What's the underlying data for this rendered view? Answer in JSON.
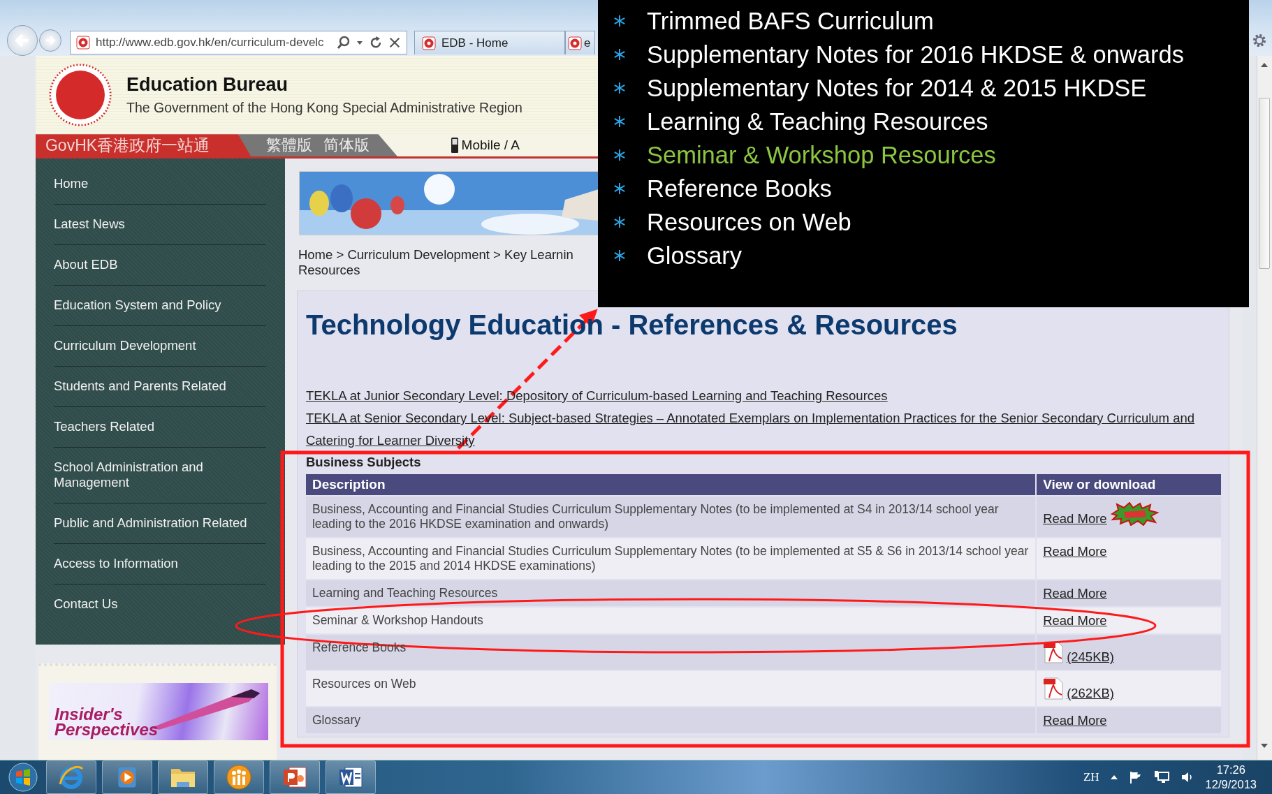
{
  "browser": {
    "address": "http://www.edb.gov.hk/en/curriculum-develc",
    "tabs": [
      {
        "label": "EDB - Home",
        "selected": false
      },
      {
        "label": "e",
        "selected": false
      }
    ]
  },
  "header": {
    "title": "Education Bureau",
    "subtitle": "The Government of the Hong Kong Special Administrative Region"
  },
  "language_bar": {
    "govhk": "GovHK香港政府一站通",
    "languages": [
      "繁體版",
      "简体版"
    ],
    "mobile": "Mobile / A"
  },
  "sidebar": {
    "items": [
      "Home",
      "Latest News",
      "About EDB",
      "Education System and Policy",
      "Curriculum Development",
      "Students and Parents Related",
      "Teachers Related",
      "School Administration and Management",
      "Public and Administration Related",
      "Access to Information",
      "Contact Us"
    ]
  },
  "promo_banner": {
    "text": "Insider's Perspectives"
  },
  "breadcrumb": [
    "Home > Curriculum Development > Key Learnin",
    "Resources"
  ],
  "content": {
    "title": "Technology Education - References & Resources",
    "links": [
      "TEKLA at Junior Secondary Level: Depository of Curriculum-based Learning and Teaching Resources",
      "TEKLA at Senior Secondary Level: Subject-based Strategies – Annotated Exemplars on Implementation Practices for the Senior Secondary Curriculum and Catering for Learner Diversity"
    ],
    "section": "Business Subjects",
    "table": {
      "columns": [
        "Description",
        "View or download"
      ],
      "rows": [
        {
          "description": "Business, Accounting and Financial Studies Curriculum Supplementary Notes (to be implemented at S4 in 2013/14 school year leading to the 2016 HKDSE examination and onwards)",
          "kind": "link",
          "view": "Read More",
          "new_badge": true
        },
        {
          "description": "Business, Accounting and Financial Studies Curriculum Supplementary Notes (to be implemented at S5 & S6 in 2013/14 school year leading to the 2015 and 2014 HKDSE examinations)",
          "kind": "link",
          "view": "Read More",
          "new_badge": false
        },
        {
          "description": "Learning and Teaching Resources",
          "kind": "link",
          "view": "Read More",
          "new_badge": false
        },
        {
          "description": "Seminar & Workshop Handouts",
          "kind": "link",
          "view": "Read More",
          "new_badge": false
        },
        {
          "description": "Reference Books",
          "kind": "pdf",
          "view": "(245KB)",
          "new_badge": false
        },
        {
          "description": "Resources on Web",
          "kind": "pdf",
          "view": "(262KB)",
          "new_badge": false
        },
        {
          "description": "Glossary",
          "kind": "link",
          "view": "Read More",
          "new_badge": false
        }
      ]
    }
  },
  "overlay": {
    "items": [
      {
        "label": "Trimmed BAFS Curriculum",
        "highlighted": false
      },
      {
        "label": "Supplementary Notes for 2016 HKDSE & onwards",
        "highlighted": false
      },
      {
        "label": "Supplementary Notes for 2014 & 2015 HKDSE",
        "highlighted": false
      },
      {
        "label": "Learning & Teaching Resources",
        "highlighted": false
      },
      {
        "label": "Seminar & Workshop Resources",
        "highlighted": true
      },
      {
        "label": "Reference Books",
        "highlighted": false
      },
      {
        "label": "Resources on Web",
        "highlighted": false
      },
      {
        "label": "Glossary",
        "highlighted": false
      }
    ]
  },
  "taskbar": {
    "apps": [
      {
        "kind": "browser"
      },
      {
        "kind": "media"
      },
      {
        "kind": "folder"
      },
      {
        "kind": "messenger"
      },
      {
        "kind": "slides"
      },
      {
        "kind": "word"
      }
    ],
    "language": "ZH",
    "time": "17:26",
    "date": "12/9/2013"
  }
}
